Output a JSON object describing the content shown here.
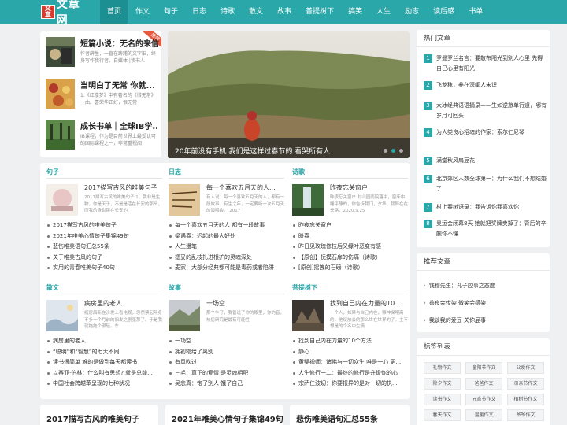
{
  "site": {
    "logo_seal": "文章",
    "logo_text": "文章网"
  },
  "nav": [
    "首页",
    "作文",
    "句子",
    "日志",
    "诗歌",
    "散文",
    "故事",
    "普提树下",
    "搞笑",
    "人生",
    "励志",
    "读后感",
    "书单"
  ],
  "featured": [
    {
      "title": "短篇小说：无名的来信",
      "desc": "作者薛生，一直在踌躇的文字旧，终身写作我行者。自媒体 |读书人",
      "badge": "推荐"
    },
    {
      "title": "当明白了无常 你就...",
      "desc": "1.《红楼梦》中有著名的《惜无常》一曲。喜荣华正好，恨无常"
    },
    {
      "title": "成长书单｜全球IB学...",
      "desc": "IB课程，作为是目前世界上最受认可的国际课程之一，非常重视阅"
    }
  ],
  "hero": {
    "caption": "20年前没有手机 我们是这样过春节的 看哭所有人"
  },
  "sections": [
    {
      "head": "句子",
      "title": "2017描写古风的唯美句子",
      "desc": "2017描写古风的唯美句子 1、我非是生物，你是天子，不是是活在长安的那头，而我的身世那在长安的",
      "list": [
        "2017描写古风的唯美句子",
        "2021年唯美心情句子集锦49句",
        "悲伤唯美语句汇总55条",
        "关于唯美古风的句子",
        "实用的青春唯美句子40句"
      ]
    },
    {
      "head": "日志",
      "title": "每一个喜欢五月天的人...",
      "desc": "有人说：每一个喜欢五月天的人，都有一段故事，有生之年，一定要听一次五月天的演唱会。 2017",
      "list": [
        "每一个喜欢五月天的人 都有一段故事",
        "梁遇春：迟起的最大好处",
        "人生漫笔",
        "摁妥的乱枝扎进根扩的灵魂深处",
        "麦家：大部分经典都可能是毒药或者陷阱"
      ]
    },
    {
      "head": "诗歌",
      "title": "昨夜忘关窗户",
      "desc": "昨夜忘关窗户 村山园雨院落中，窗床中睡平静的，你告诉我门，夕华，我醉在在季路。2020.9.25",
      "list": [
        "昨夜忘关窗户",
        "盼春",
        "昨日见玫瑰修枝后又绿叶恶变有感",
        "【原创】抚摸石扉的伤痛（诗歌）",
        "[原创]摇拽的石磅（诗歌）"
      ]
    },
    {
      "head": "散文",
      "title": "病房里的老人",
      "desc": "病房后新在汾发上看电视，忽然禁起年身不多一个月前的旧发之剧张那了。于是我就拖拖个很轻。东",
      "list": [
        "病房里的老人",
        "“聪明”和“智慧”的七大不同",
        "读书很简单 难的是做到每天都读书",
        "以赛亚·伯林：什么叫有思想? 就是总能...",
        "中国社会跨越苯呈现的七种状况"
      ]
    },
    {
      "head": "故事",
      "title": "一场空",
      "desc": "那个牛仔，我曾逢了你的眼里，你的音，热俗研究是最有可能性",
      "list": [
        "一场空",
        "拥初物给了离别",
        "有风吹过",
        "三毛：真正的爱情 是灵魂相配",
        "吴念真：饱了别人 饿了自己"
      ]
    },
    {
      "head": "菩提树下",
      "title": "找到自己内在力量的10...",
      "desc": "一个人，如果与自己内在，稀神探喂高的，他绽放会的那么世在世界的了。主不想是的个名中生情",
      "list": [
        "找到自己内在力量的10个方法",
        "静心",
        "黄檗禅师：诸佛与一切众生 唯是一心 更...",
        "人生修行一二：最终的修行是升级你的心",
        "宗萨仁波切：你要报异的是对一切的执..."
      ]
    }
  ],
  "bottom_cards": [
    "2017描写古风的唯美句子",
    "2021年唯美心情句子集锦49句",
    "悲伤唯美语句汇总55条"
  ],
  "sidebar": {
    "hot_head": "热门文章",
    "hot": [
      "罗曼罗兰名言：要散布阳光到别人心里 先得自己心里有阳光",
      "飞龙稼，养在深闺人未识",
      "大冰经典语语摘录——生如逆旅单行道，哪有岁月可回头",
      "为人类良心招魂的作家：索尔仁尼琴",
      "满堂秋风扇豆花",
      "北京郊区人数全球第一：为什么我们不想结婚了",
      "村上春树语录：我告诉你我喜欢你",
      "奥运会闭幕8天 她就把奖牌卖掉了：背后的辛酸你不懂"
    ],
    "rec_head": "推荐文章",
    "rec": [
      "钱穆先生：孔子应事之态度",
      "善良会传染 微笑会感染",
      "我谈我的爱豆 关你屁事"
    ],
    "tags_head": "标签列表",
    "tags": [
      "礼物作文",
      "童阳节作文",
      "父爱作文",
      "除夕作文",
      "爸爸作文",
      "母亲节作文",
      "读书作文",
      "元宵节作文",
      "植树节作文",
      "春天作文",
      "温暖作文",
      "爷爷作文",
      "",
      "",
      ""
    ]
  }
}
